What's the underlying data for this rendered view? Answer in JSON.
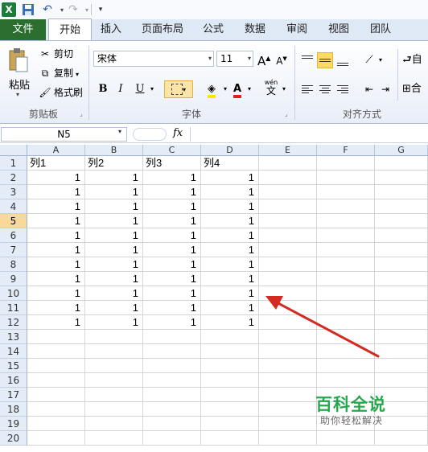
{
  "qat": {
    "logo": "X"
  },
  "tabs": [
    "文件",
    "开始",
    "插入",
    "页面布局",
    "公式",
    "数据",
    "审阅",
    "视图",
    "团队"
  ],
  "clipboard": {
    "paste": "粘贴",
    "cut": "剪切",
    "copy": "复制",
    "format_painter": "格式刷",
    "group_label": "剪贴板"
  },
  "font": {
    "name": "宋体",
    "size": "11",
    "bold": "B",
    "italic": "I",
    "underline": "U",
    "grow": "A",
    "shrink": "A",
    "font_color": "A",
    "phonetic": "wén",
    "phonetic_char": "文",
    "group_label": "字体"
  },
  "alignment": {
    "group_label": "对齐方式",
    "wrap_prefix": "自",
    "merge_prefix": "合"
  },
  "formula_bar": {
    "name_box": "N5",
    "fx": "fx",
    "value": ""
  },
  "sheet": {
    "columns": [
      "A",
      "B",
      "C",
      "D",
      "E",
      "F",
      "G"
    ],
    "rows": [
      "1",
      "2",
      "3",
      "4",
      "5",
      "6",
      "7",
      "8",
      "9",
      "10",
      "11",
      "12",
      "13",
      "14",
      "15",
      "16",
      "17",
      "18",
      "19",
      "20"
    ],
    "active_row": "5",
    "headers": [
      "列1",
      "列2",
      "列3",
      "列4"
    ],
    "data": [
      [
        "1",
        "1",
        "1",
        "1"
      ],
      [
        "1",
        "1",
        "1",
        "1"
      ],
      [
        "1",
        "1",
        "1",
        "1"
      ],
      [
        "1",
        "1",
        "1",
        "1"
      ],
      [
        "1",
        "1",
        "1",
        "1"
      ],
      [
        "1",
        "1",
        "1",
        "1"
      ],
      [
        "1",
        "1",
        "1",
        "1"
      ],
      [
        "1",
        "1",
        "1",
        "1"
      ],
      [
        "1",
        "1",
        "1",
        "1"
      ],
      [
        "1",
        "1",
        "1",
        "1"
      ],
      [
        "1",
        "1",
        "1",
        "1"
      ]
    ]
  },
  "watermark": {
    "title": "百科全说",
    "subtitle": "助你轻松解决"
  },
  "colors": {
    "file_tab": "#2b6e2f",
    "annotation_arrow": "#d32a22",
    "watermark_green": "#27a84e",
    "active_row_header": "#f9d99b"
  }
}
